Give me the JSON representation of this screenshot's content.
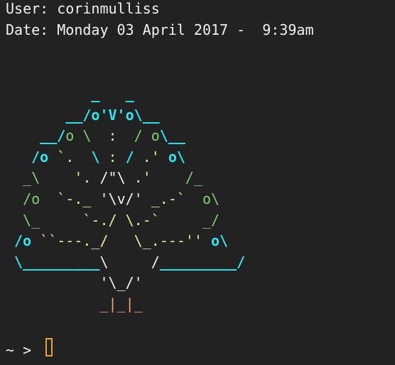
{
  "header": {
    "user_label": "User: ",
    "user_value": "corinmulliss",
    "date_label": "Date: ",
    "date_value": "Monday 03 April 2017 -  9:39am"
  },
  "art": {
    "rows": [
      [
        {
          "t": "          ",
          "c": "w"
        },
        {
          "t": "_   _",
          "c": "c"
        }
      ],
      [
        {
          "t": "       ",
          "c": "w"
        },
        {
          "t": "__/o'V'o\\__",
          "c": "c"
        }
      ],
      [
        {
          "t": "    ",
          "c": "w"
        },
        {
          "t": "__/",
          "c": "c"
        },
        {
          "t": "o \\  ",
          "c": "g"
        },
        {
          "t": ":",
          "c": "y"
        },
        {
          "t": "  / o",
          "c": "g"
        },
        {
          "t": "\\__",
          "c": "c"
        }
      ],
      [
        {
          "t": "   ",
          "c": "w"
        },
        {
          "t": "/o",
          "c": "c"
        },
        {
          "t": " `.  ",
          "c": "y"
        },
        {
          "t": "\\ ",
          "c": "c"
        },
        {
          "t": ":",
          "c": "y"
        },
        {
          "t": " / ",
          "c": "c"
        },
        {
          "t": ".' ",
          "c": "y"
        },
        {
          "t": "o\\",
          "c": "c"
        }
      ],
      [
        {
          "t": "  ",
          "c": "w"
        },
        {
          "t": "_\\",
          "c": "g"
        },
        {
          "t": "    '. ",
          "c": "y"
        },
        {
          "t": "/\"\\",
          "c": "w"
        },
        {
          "t": " .'",
          "c": "y"
        },
        {
          "t": "    /_",
          "c": "g"
        }
      ],
      [
        {
          "t": "  ",
          "c": "w"
        },
        {
          "t": "/o",
          "c": "g"
        },
        {
          "t": "  `-._ ",
          "c": "y"
        },
        {
          "t": "'\\v/'",
          "c": "w"
        },
        {
          "t": " _.-`",
          "c": "y"
        },
        {
          "t": "  o\\",
          "c": "g"
        }
      ],
      [
        {
          "t": "  ",
          "c": "w"
        },
        {
          "t": "\\_",
          "c": "g"
        },
        {
          "t": "     `-./ \\.-`",
          "c": "y"
        },
        {
          "t": "     _/",
          "c": "g"
        }
      ],
      [
        {
          "t": " ",
          "c": "w"
        },
        {
          "t": "/o",
          "c": "c"
        },
        {
          "t": " ``---._/",
          "c": "y"
        },
        {
          "t": "   \\_.---''",
          "c": "y"
        },
        {
          "t": " o\\",
          "c": "c"
        }
      ],
      [
        {
          "t": " ",
          "c": "w"
        },
        {
          "t": "\\_________",
          "c": "c"
        },
        {
          "t": "\\",
          "c": "w"
        },
        {
          "t": "     ",
          "c": "w"
        },
        {
          "t": "/",
          "c": "w"
        },
        {
          "t": "_________/",
          "c": "c"
        }
      ],
      [
        {
          "t": "           ",
          "c": "w"
        },
        {
          "t": "'\\_/'",
          "c": "w"
        }
      ],
      [
        {
          "t": "           ",
          "c": "w"
        },
        {
          "t": "_|_|_",
          "c": "o"
        }
      ]
    ]
  },
  "prompt": {
    "symbol": "~ > "
  },
  "colors": {
    "background": "#222222",
    "cyan": "#2ee6ee",
    "green": "#7fcf72",
    "yellow": "#f0e69a",
    "feet": "#f0a37a",
    "cursor": "#e6a43a"
  }
}
